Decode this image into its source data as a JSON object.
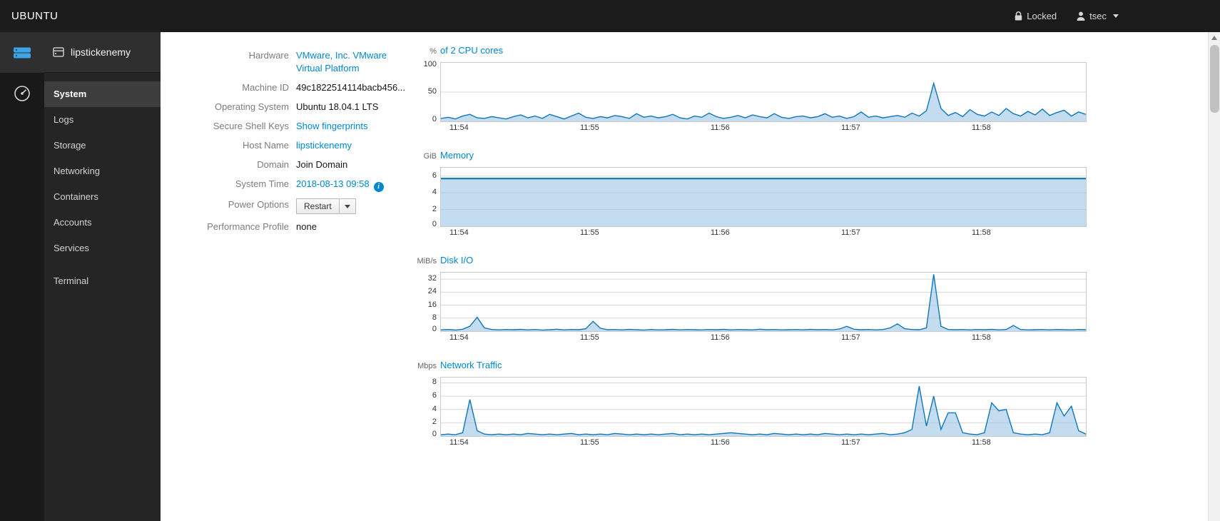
{
  "topbar": {
    "brand": "UBUNTU",
    "locked_label": "Locked",
    "user_label": "tsec"
  },
  "sidebar": {
    "host": "lipstickenemy",
    "items": [
      {
        "label": "System",
        "active": true
      },
      {
        "label": "Logs"
      },
      {
        "label": "Storage"
      },
      {
        "label": "Networking"
      },
      {
        "label": "Containers"
      },
      {
        "label": "Accounts"
      },
      {
        "label": "Services"
      },
      {
        "label": "Terminal",
        "gap": true
      }
    ]
  },
  "system": {
    "fields": [
      {
        "label": "Hardware",
        "type": "link",
        "value": "VMware, Inc. VMware Virtual Platform",
        "lines": [
          "VMware, Inc. VMware",
          "Virtual Platform"
        ]
      },
      {
        "label": "Machine ID",
        "type": "text",
        "value": "49c1822514114bacb456...",
        "interactable": false
      },
      {
        "label": "Operating System",
        "type": "text",
        "value": "Ubuntu 18.04.1 LTS",
        "interactable": false
      },
      {
        "label": "Secure Shell Keys",
        "type": "link",
        "value": "Show fingerprints"
      },
      {
        "label": "Host Name",
        "type": "link",
        "value": "lipstickenemy"
      },
      {
        "label": "Domain",
        "type": "text",
        "value": "Join Domain",
        "interactable": true
      },
      {
        "label": "System Time",
        "type": "link-info",
        "value": "2018-08-13 09:58"
      },
      {
        "label": "Power Options",
        "type": "split-button",
        "value": "Restart"
      },
      {
        "label": "Performance Profile",
        "type": "text",
        "value": "none",
        "interactable": false
      }
    ]
  },
  "colors": {
    "accent": "#0088ce",
    "chart_line": "#0f77b8",
    "chart_fill": "rgba(148,192,226,0.55)",
    "grid": "#d8d8d8"
  },
  "chart_data": [
    {
      "type": "area",
      "unit": "%",
      "title": "of 2 CPU cores",
      "ylim": [
        0,
        100
      ],
      "yticks": [
        0,
        50,
        100
      ],
      "xlabels": [
        "11:54",
        "11:55",
        "11:56",
        "11:57",
        "11:58"
      ],
      "line_width": 1.4,
      "values": [
        5,
        7,
        4,
        9,
        12,
        6,
        5,
        8,
        6,
        4,
        8,
        11,
        6,
        9,
        5,
        12,
        8,
        4,
        9,
        14,
        7,
        5,
        8,
        6,
        10,
        8,
        5,
        13,
        7,
        9,
        6,
        8,
        12,
        6,
        4,
        9,
        7,
        14,
        8,
        5,
        7,
        10,
        6,
        11,
        8,
        6,
        13,
        7,
        5,
        8,
        9,
        6,
        8,
        13,
        7,
        9,
        5,
        8,
        16,
        7,
        9,
        6,
        8,
        10,
        7,
        14,
        9,
        18,
        65,
        22,
        10,
        15,
        8,
        20,
        12,
        9,
        16,
        10,
        22,
        13,
        9,
        17,
        11,
        21,
        10,
        15,
        19,
        9,
        16,
        12
      ]
    },
    {
      "type": "area",
      "unit": "GiB",
      "title": "Memory",
      "ylim": [
        0,
        7
      ],
      "yticks": [
        0,
        2,
        4,
        6
      ],
      "xlabels": [
        "11:54",
        "11:55",
        "11:56",
        "11:57",
        "11:58"
      ],
      "line_width": 2.2,
      "values": [
        5.7,
        5.7,
        5.7,
        5.7,
        5.7,
        5.7,
        5.7,
        5.7,
        5.7,
        5.7
      ]
    },
    {
      "type": "area",
      "unit": "MiB/s",
      "title": "Disk I/O",
      "ylim": [
        0,
        36
      ],
      "yticks": [
        0,
        8,
        16,
        24,
        32
      ],
      "xlabels": [
        "11:54",
        "11:55",
        "11:56",
        "11:57",
        "11:58"
      ],
      "line_width": 1.4,
      "values": [
        0.8,
        1,
        0.7,
        1.2,
        3,
        8.5,
        2,
        1,
        0.8,
        1,
        0.9,
        1.1,
        0.8,
        1,
        0.7,
        0.9,
        1.2,
        0.8,
        1,
        0.9,
        1.5,
        6,
        1.8,
        0.9,
        1,
        0.8,
        1.1,
        0.9,
        0.7,
        1,
        0.8,
        0.9,
        1.1,
        0.8,
        1,
        0.9,
        0.8,
        1,
        0.9,
        1.1,
        0.8,
        1,
        0.9,
        0.8,
        1.2,
        0.9,
        1,
        0.8,
        0.9,
        1,
        0.8,
        1.1,
        0.9,
        1,
        0.8,
        1.3,
        3,
        1.2,
        0.9,
        1,
        0.8,
        1,
        2,
        4.5,
        1.5,
        1,
        0.9,
        2,
        35,
        3,
        1,
        0.9,
        1,
        0.8,
        1,
        0.9,
        1.1,
        0.8,
        1,
        3.5,
        1,
        0.8,
        0.9,
        1,
        0.8,
        1,
        0.9,
        0.8,
        1,
        0.9
      ]
    },
    {
      "type": "area",
      "unit": "Mbps",
      "title": "Network Traffic",
      "ylim": [
        0,
        8.8
      ],
      "yticks": [
        0,
        2,
        4,
        6,
        8
      ],
      "xlabels": [
        "11:54",
        "11:55",
        "11:56",
        "11:57",
        "11:58"
      ],
      "line_width": 1.4,
      "values": [
        0.2,
        0.3,
        0.2,
        0.5,
        5.5,
        0.8,
        0.3,
        0.2,
        0.3,
        0.2,
        0.3,
        0.2,
        0.4,
        0.3,
        0.2,
        0.3,
        0.2,
        0.3,
        0.4,
        0.2,
        0.3,
        0.2,
        0.3,
        0.2,
        0.4,
        0.3,
        0.2,
        0.3,
        0.2,
        0.3,
        0.2,
        0.3,
        0.4,
        0.2,
        0.3,
        0.2,
        0.3,
        0.2,
        0.3,
        0.4,
        0.5,
        0.4,
        0.3,
        0.2,
        0.3,
        0.2,
        0.4,
        0.3,
        0.2,
        0.3,
        0.2,
        0.3,
        0.2,
        0.4,
        0.3,
        0.2,
        0.3,
        0.2,
        0.3,
        0.2,
        0.3,
        0.4,
        0.2,
        0.3,
        0.5,
        1,
        7.5,
        1.5,
        6,
        1,
        3.5,
        3.5,
        0.5,
        0.3,
        0.2,
        0.5,
        5,
        3.8,
        4,
        0.5,
        0.3,
        0.2,
        0.3,
        0.2,
        0.5,
        5,
        3,
        4.5,
        0.8,
        0.3
      ]
    }
  ]
}
